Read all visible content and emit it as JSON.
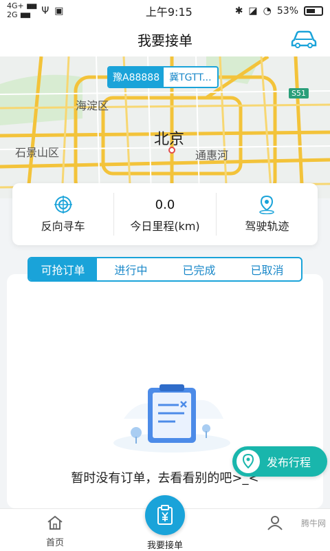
{
  "status_bar": {
    "network_top": "4G+",
    "network_bottom": "2G",
    "time": "上午9:15",
    "battery": "53%"
  },
  "header": {
    "title": "我要接单",
    "right_icon": "car-icon"
  },
  "map": {
    "plate_primary": "豫A88888",
    "plate_secondary": "冀TGTT...",
    "city_label": "北京",
    "district_labels": [
      "海淀区",
      "石景山区",
      "通惠河"
    ],
    "road_badge": "S51"
  },
  "stats": {
    "reverse_find": "反向寻车",
    "mileage_value": "0.0",
    "mileage_label": "今日里程(km)",
    "track_label": "驾驶轨迹"
  },
  "tabs": [
    {
      "label": "可抢订单",
      "active": true
    },
    {
      "label": "进行中",
      "active": false
    },
    {
      "label": "已完成",
      "active": false
    },
    {
      "label": "已取消",
      "active": false
    }
  ],
  "empty_state": {
    "message": "暂时没有订单，去看看别的吧>_<"
  },
  "publish": {
    "label": "发布行程"
  },
  "bottom_nav": {
    "home": "首页",
    "take_order": "我要接单",
    "watermark": "腾牛网"
  },
  "colors": {
    "accent": "#1aa3d9",
    "publish": "#19b6ac"
  }
}
